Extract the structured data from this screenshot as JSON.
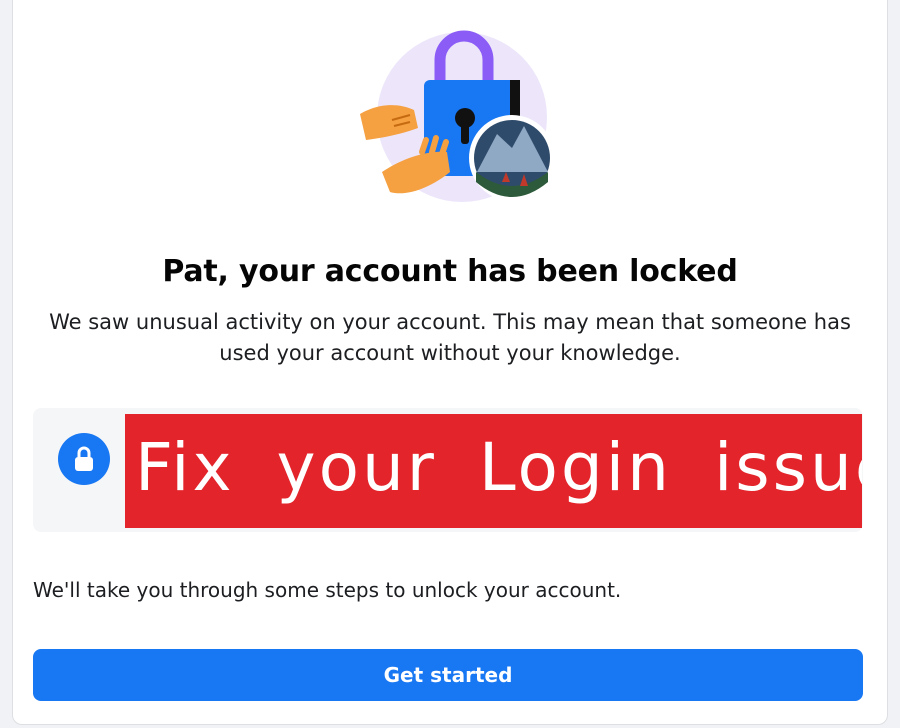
{
  "page": {
    "title": "Pat, your account has been locked",
    "description": "We saw unusual activity on your account. This may mean that someone has used your account without your knowledge.",
    "info_banner": {
      "icon": "lock-icon",
      "overlay_text": "Fix your Login issues"
    },
    "steps_text": "We'll take you through some steps to unlock your account.",
    "cta_label": "Get started"
  },
  "colors": {
    "brand_blue": "#1877f2",
    "overlay_red": "#e3242b",
    "lock_shackle": "#8b5cf6",
    "hero_bg": "#ede6fb",
    "hands": "#f5a041"
  }
}
